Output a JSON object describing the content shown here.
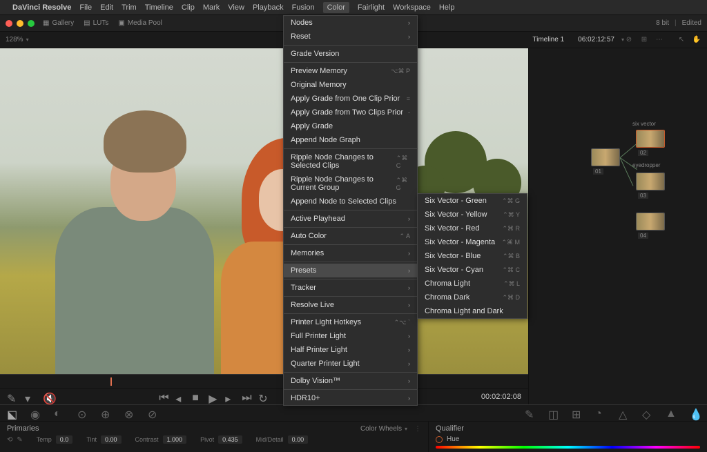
{
  "menubar": {
    "app": "DaVinci Resolve",
    "items": [
      "File",
      "Edit",
      "Trim",
      "Timeline",
      "Clip",
      "Mark",
      "View",
      "Playback",
      "Fusion",
      "Color",
      "Fairlight",
      "Workspace",
      "Help"
    ],
    "highlighted": "Color"
  },
  "toolbar": {
    "gallery": "Gallery",
    "luts": "LUTs",
    "mediapool": "Media Pool",
    "bitdepth": "8 bit",
    "edited": "Edited"
  },
  "subbar": {
    "zoom": "128%",
    "timeline": "Timeline 1",
    "timecode": "06:02:12:57"
  },
  "dropdown": {
    "items": [
      {
        "label": "Nodes",
        "arrow": true
      },
      {
        "label": "Reset",
        "arrow": true
      },
      {
        "sep": true
      },
      {
        "label": "Grade Version"
      },
      {
        "sep": true
      },
      {
        "label": "Preview Memory",
        "shortcut": "⌥⌘ P"
      },
      {
        "label": "Original Memory"
      },
      {
        "label": "Apply Grade from One Clip Prior",
        "shortcut": "="
      },
      {
        "label": "Apply Grade from Two Clips Prior",
        "shortcut": "-"
      },
      {
        "label": "Apply Grade"
      },
      {
        "label": "Append Node Graph"
      },
      {
        "sep": true
      },
      {
        "label": "Ripple Node Changes to Selected Clips",
        "shortcut": "⌃⌘ C"
      },
      {
        "label": "Ripple Node Changes to Current Group",
        "shortcut": "⌃⌘ G"
      },
      {
        "label": "Append Node to Selected Clips"
      },
      {
        "sep": true
      },
      {
        "label": "Active Playhead",
        "arrow": true
      },
      {
        "sep": true
      },
      {
        "label": "Auto Color",
        "shortcut": "⌃ A"
      },
      {
        "sep": true
      },
      {
        "label": "Memories",
        "arrow": true
      },
      {
        "sep": true
      },
      {
        "label": "Presets",
        "arrow": true,
        "selected": true
      },
      {
        "sep": true
      },
      {
        "label": "Tracker",
        "arrow": true
      },
      {
        "sep": true
      },
      {
        "label": "Resolve Live",
        "arrow": true
      },
      {
        "sep": true
      },
      {
        "label": "Printer Light Hotkeys",
        "shortcut": "⌃⌥ `"
      },
      {
        "label": "Full Printer Light",
        "arrow": true
      },
      {
        "label": "Half Printer Light",
        "arrow": true
      },
      {
        "label": "Quarter Printer Light",
        "arrow": true
      },
      {
        "sep": true
      },
      {
        "label": "Dolby Vision™",
        "arrow": true
      },
      {
        "sep": true
      },
      {
        "label": "HDR10+",
        "arrow": true
      }
    ]
  },
  "submenu": {
    "items": [
      {
        "label": "Six Vector - Green",
        "shortcut": "⌃⌘ G"
      },
      {
        "label": "Six Vector - Yellow",
        "shortcut": "⌃⌘ Y"
      },
      {
        "label": "Six Vector - Red",
        "shortcut": "⌃⌘ R"
      },
      {
        "label": "Six Vector - Magenta",
        "shortcut": "⌃⌘ M"
      },
      {
        "label": "Six Vector - Blue",
        "shortcut": "⌃⌘ B"
      },
      {
        "label": "Six Vector - Cyan",
        "shortcut": "⌃⌘ C"
      },
      {
        "label": "Chroma Light",
        "shortcut": "⌃⌘ L"
      },
      {
        "label": "Chroma Dark",
        "shortcut": "⌃⌘ D"
      },
      {
        "label": "Chroma Light and Dark"
      }
    ]
  },
  "nodes": {
    "label1": "six vector",
    "label2": "eyedropper",
    "n1": "01",
    "n2": "02",
    "n3": "03",
    "n4": "04"
  },
  "transport": {
    "timecode": "00:02:02:08"
  },
  "primaries": {
    "title": "Primaries",
    "mode": "Color Wheels",
    "temp_label": "Temp",
    "temp_value": "0.0",
    "tint_label": "Tint",
    "tint_value": "0.00",
    "contrast_label": "Contrast",
    "contrast_value": "1.000",
    "pivot_label": "Pivot",
    "pivot_value": "0.435",
    "mid_label": "Mid/Detail",
    "mid_value": "0.00"
  },
  "qualifier": {
    "title": "Qualifier",
    "hue": "Hue"
  }
}
